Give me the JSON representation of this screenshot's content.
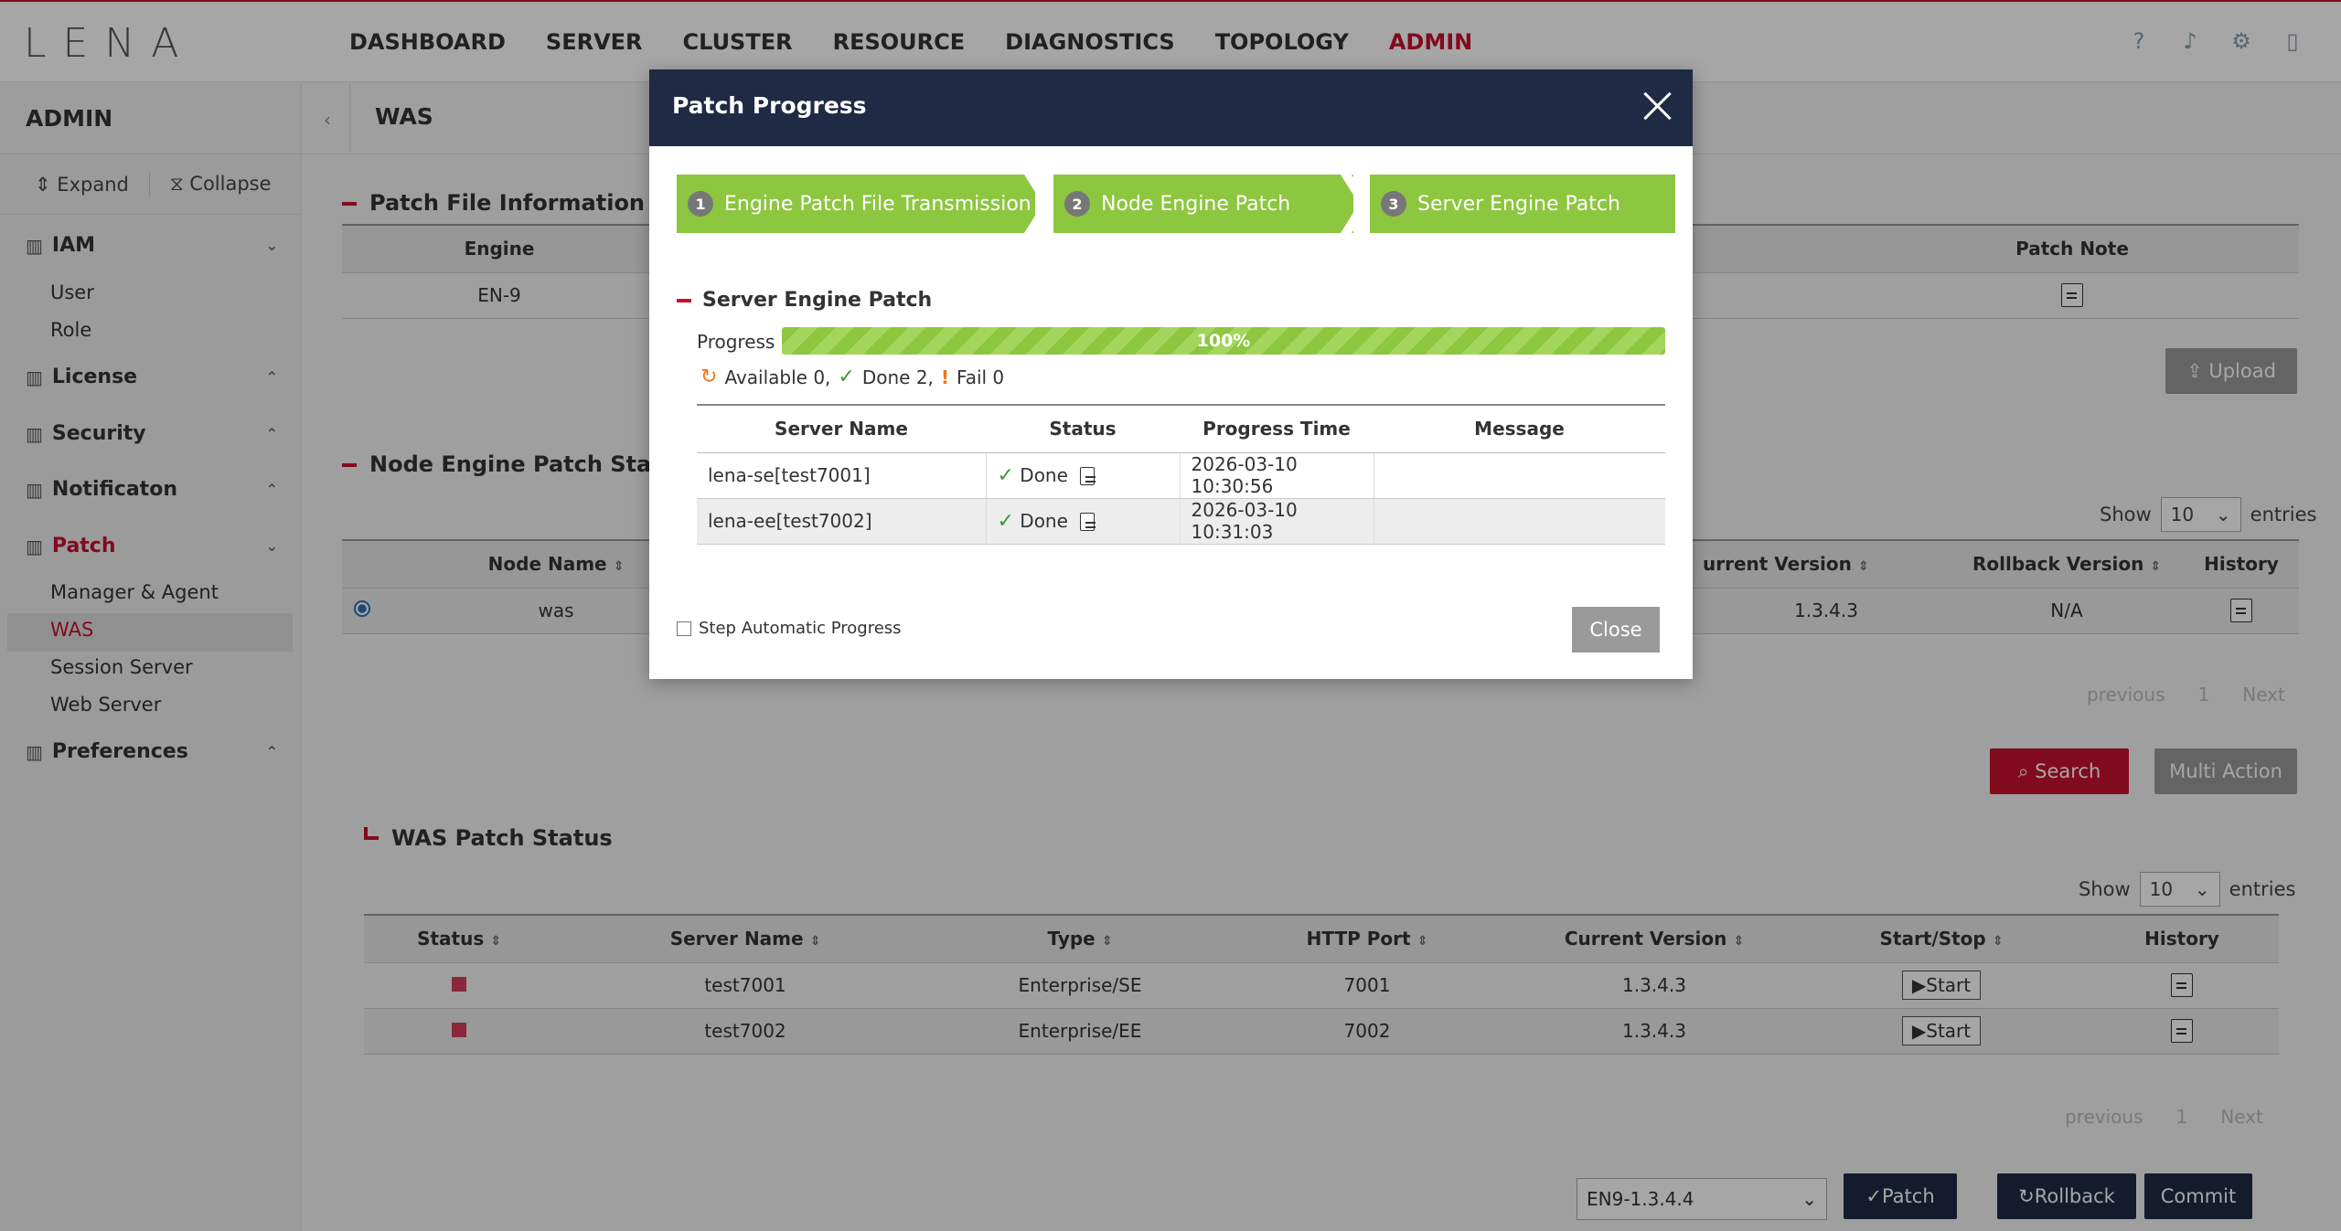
{
  "app": {
    "logo": "LENA"
  },
  "nav": [
    "DASHBOARD",
    "SERVER",
    "CLUSTER",
    "RESOURCE",
    "DIAGNOSTICS",
    "TOPOLOGY",
    "ADMIN"
  ],
  "sidebar": {
    "title": "ADMIN",
    "expand": "Expand",
    "collapse": "Collapse",
    "sections": [
      "IAM",
      "License",
      "Security",
      "Notificaton",
      "Patch",
      "Preferences"
    ],
    "iam_items": [
      "User",
      "Role"
    ],
    "patch_items": [
      "Manager & Agent",
      "WAS",
      "Session Server",
      "Web Server"
    ]
  },
  "breadcrumb": {
    "title": "WAS"
  },
  "patch_file": {
    "title": "Patch File Information",
    "columns": [
      "Engine",
      "Patch Note"
    ],
    "engine": "EN-9",
    "upload": "Upload"
  },
  "node_status": {
    "title": "Node Engine Patch Status",
    "show": "Show",
    "entries_value": "10",
    "entries": "entries",
    "columns": [
      "Node Name",
      "urrent Version",
      "Rollback Version",
      "History"
    ],
    "row": {
      "node": "was",
      "current": "1.3.4.3",
      "rollback": "N/A"
    },
    "pager": {
      "prev": "previous",
      "page": "1",
      "next": "Next"
    },
    "search": "Search",
    "multi": "Multi Action"
  },
  "was_status": {
    "title": "WAS Patch Status",
    "show": "Show",
    "entries_value": "10",
    "entries": "entries",
    "columns": [
      "Status",
      "Server Name",
      "Type",
      "HTTP Port",
      "Current Version",
      "Start/Stop",
      "History"
    ],
    "rows": [
      {
        "server": "test7001",
        "type": "Enterprise/SE",
        "port": "7001",
        "version": "1.3.4.3",
        "action": "Start"
      },
      {
        "server": "test7002",
        "type": "Enterprise/EE",
        "port": "7002",
        "version": "1.3.4.3",
        "action": "Start"
      }
    ],
    "pager": {
      "prev": "previous",
      "page": "1",
      "next": "Next"
    },
    "version_select": "EN9-1.3.4.4",
    "patch": "Patch",
    "rollback": "Rollback",
    "commit": "Commit"
  },
  "modal": {
    "title": "Patch Progress",
    "steps": [
      {
        "num": "1",
        "label": "Engine Patch File Transmission"
      },
      {
        "num": "2",
        "label": "Node Engine Patch"
      },
      {
        "num": "3",
        "label": "Server Engine Patch"
      }
    ],
    "section": "Server Engine Patch",
    "progress_label": "Progress",
    "progress_text": "100%",
    "progress_value": 100,
    "summary": {
      "available": "Available 0,",
      "done": "Done 2,",
      "fail": "Fail 0"
    },
    "columns": [
      "Server Name",
      "Status",
      "Progress Time",
      "Message"
    ],
    "rows": [
      {
        "server": "lena-se[test7001]",
        "status": "Done",
        "time": "2026-03-10 10:30:56",
        "message": ""
      },
      {
        "server": "lena-ee[test7002]",
        "status": "Done",
        "time": "2026-03-10 10:31:03",
        "message": ""
      }
    ],
    "step_auto": "Step Automatic Progress",
    "close": "Close"
  },
  "colors": {
    "accent": "#c8102e",
    "modal_header": "#1f2a44",
    "step_green": "#8dc63f"
  }
}
